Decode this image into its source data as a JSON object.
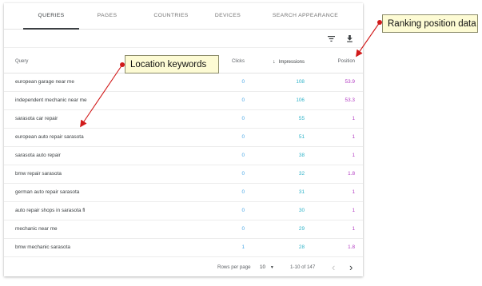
{
  "tabs": [
    "QUERIES",
    "PAGES",
    "COUNTRIES",
    "DEVICES",
    "SEARCH APPEARANCE"
  ],
  "toolbar": {
    "filter_icon": "filter-icon",
    "download_icon": "download-icon"
  },
  "table": {
    "headers": {
      "query": "Query",
      "clicks": "Clicks",
      "impressions": "Impressions",
      "position": "Position"
    },
    "rows": [
      {
        "query": "european garage near me",
        "clicks": "0",
        "impressions": "108",
        "position": "53.9"
      },
      {
        "query": "independent mechanic near me",
        "clicks": "0",
        "impressions": "106",
        "position": "53.3"
      },
      {
        "query": "sarasota car repair",
        "clicks": "0",
        "impressions": "55",
        "position": "1"
      },
      {
        "query": "european auto repair sarasota",
        "clicks": "0",
        "impressions": "51",
        "position": "1"
      },
      {
        "query": "sarasota auto repair",
        "clicks": "0",
        "impressions": "38",
        "position": "1"
      },
      {
        "query": "bmw repair sarasota",
        "clicks": "0",
        "impressions": "32",
        "position": "1.8"
      },
      {
        "query": "german auto repair sarasota",
        "clicks": "0",
        "impressions": "31",
        "position": "1"
      },
      {
        "query": "auto repair shops in sarasota fl",
        "clicks": "0",
        "impressions": "30",
        "position": "1"
      },
      {
        "query": "mechanic near me",
        "clicks": "0",
        "impressions": "29",
        "position": "1"
      },
      {
        "query": "bmw mechanic sarasota",
        "clicks": "1",
        "impressions": "28",
        "position": "1.8"
      }
    ]
  },
  "pagination": {
    "rows_per_page_label": "Rows per page",
    "rows_per_page_value": "10",
    "range": "1-10 of 147"
  },
  "annotations": {
    "location": "Location keywords",
    "ranking": "Ranking position data"
  },
  "colors": {
    "clicks": "#4aa7e6",
    "impressions": "#2fb3c9",
    "position": "#b23ac2",
    "callout_bg": "#fdfbd4",
    "arrow": "#d11a1a"
  }
}
